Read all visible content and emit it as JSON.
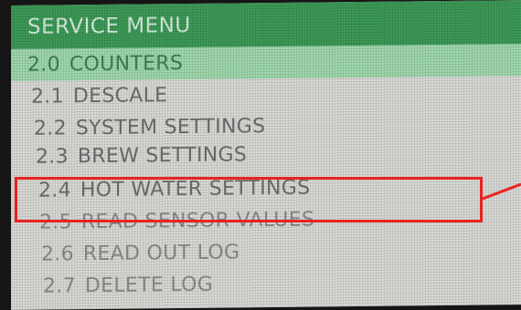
{
  "menu": {
    "title": "SERVICE MENU",
    "items": [
      {
        "num": "2.0",
        "label": "COUNTERS",
        "selected": true
      },
      {
        "num": "2.1",
        "label": "DESCALE",
        "selected": false
      },
      {
        "num": "2.2",
        "label": "SYSTEM SETTINGS",
        "selected": false
      },
      {
        "num": "2.3",
        "label": "BREW SETTINGS",
        "selected": false
      },
      {
        "num": "2.4",
        "label": "HOT WATER SETTINGS",
        "selected": false,
        "highlighted": true
      },
      {
        "num": "2.5",
        "label": "READ SENSOR VALUES",
        "selected": false
      },
      {
        "num": "2.6",
        "label": "READ OUT LOG",
        "selected": false
      },
      {
        "num": "2.7",
        "label": "DELETE LOG",
        "selected": false
      }
    ]
  },
  "colors": {
    "header": "#3c9a57",
    "selected_row": "#9fd8ad",
    "annotation": "#ea2222"
  }
}
